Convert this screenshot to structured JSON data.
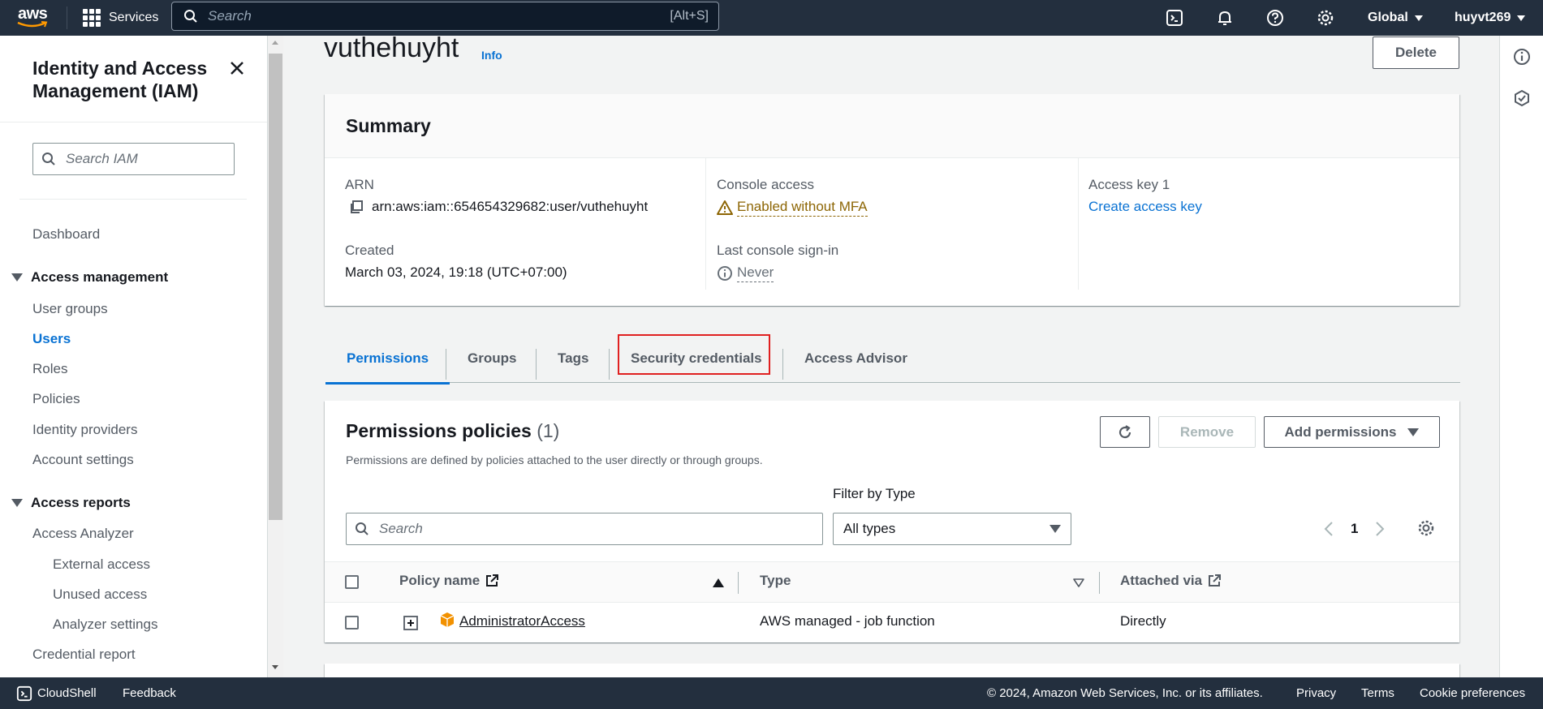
{
  "topnav": {
    "logo_text": "aws",
    "services_label": "Services",
    "search_placeholder": "Search",
    "search_shortcut": "[Alt+S]",
    "region_label": "Global",
    "user_label": "huyvt269"
  },
  "sidebar": {
    "title": "Identity and Access Management (IAM)",
    "search_placeholder": "Search IAM",
    "dashboard": "Dashboard",
    "access_management": {
      "label": "Access management",
      "items": [
        "User groups",
        "Users",
        "Roles",
        "Policies",
        "Identity providers",
        "Account settings"
      ]
    },
    "access_reports": {
      "label": "Access reports",
      "items": [
        "Access Analyzer",
        "External access",
        "Unused access",
        "Analyzer settings",
        "Credential report"
      ]
    }
  },
  "page": {
    "title": "vuthehuyht",
    "info_label": "Info",
    "delete_label": "Delete"
  },
  "summary": {
    "title": "Summary",
    "arn_label": "ARN",
    "arn_value": "arn:aws:iam::654654329682:user/vuthehuyht",
    "created_label": "Created",
    "created_value": "March 03, 2024, 19:18 (UTC+07:00)",
    "console_access_label": "Console access",
    "console_access_value": "Enabled without MFA",
    "last_signin_label": "Last console sign-in",
    "last_signin_value": "Never",
    "access_key_label": "Access key 1",
    "access_key_value": "Create access key"
  },
  "tabs": [
    "Permissions",
    "Groups",
    "Tags",
    "Security credentials",
    "Access Advisor"
  ],
  "permissions": {
    "title": "Permissions policies",
    "count": "(1)",
    "description": "Permissions are defined by policies attached to the user directly or through groups.",
    "remove_label": "Remove",
    "add_label": "Add permissions",
    "filter_label": "Filter by Type",
    "search_placeholder": "Search",
    "filter_value": "All types",
    "page_number": "1",
    "columns": {
      "policy_name": "Policy name",
      "type": "Type",
      "attached_via": "Attached via"
    },
    "rows": [
      {
        "name": "AdministratorAccess",
        "type": "AWS managed - job function",
        "attached": "Directly"
      }
    ]
  },
  "footer": {
    "cloudshell": "CloudShell",
    "feedback": "Feedback",
    "copyright": "© 2024, Amazon Web Services, Inc. or its affiliates.",
    "privacy": "Privacy",
    "terms": "Terms",
    "cookies": "Cookie preferences"
  },
  "colors": {
    "nav_bg": "#232f3e",
    "link": "#0972d3",
    "warning": "#8d6605",
    "highlight_box": "#e02020"
  }
}
